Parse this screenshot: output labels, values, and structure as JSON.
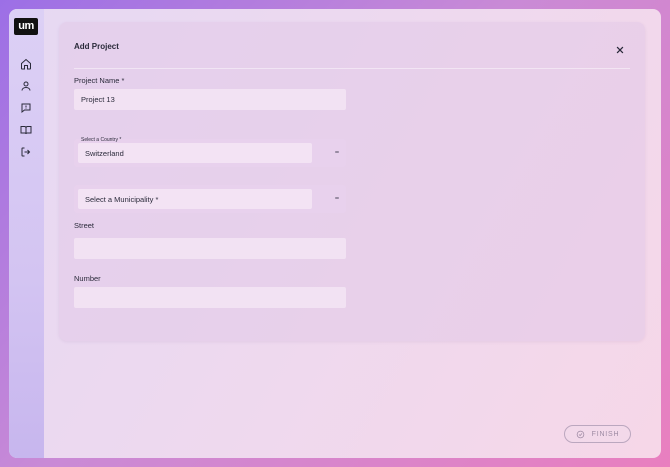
{
  "logo": {
    "text": "um"
  },
  "sidebar": {
    "items": [
      {
        "name": "home",
        "icon": "home-icon"
      },
      {
        "name": "profile",
        "icon": "user-icon"
      },
      {
        "name": "messages",
        "icon": "message-alert-icon"
      },
      {
        "name": "docs",
        "icon": "book-open-icon"
      },
      {
        "name": "logout",
        "icon": "logout-icon"
      }
    ]
  },
  "dialog": {
    "title": "Add Project",
    "close_icon": "close-icon",
    "project_name": {
      "label": "Project Name *",
      "value": "Project 13"
    },
    "country": {
      "label": "Select a Country *",
      "value": "Switzerland"
    },
    "municipality": {
      "placeholder": "Select a Municipality *",
      "value": ""
    },
    "street": {
      "label": "Street",
      "value": ""
    },
    "number": {
      "label": "Number",
      "value": ""
    }
  },
  "footer": {
    "finish_label": "FINISH",
    "finish_icon": "check-circle-icon"
  },
  "colors": {
    "sidebar_bg": "#d3c4f2",
    "panel_bg": "#e1c8e8",
    "finish_border": "#bba7bf",
    "finish_text": "#9d8aa3",
    "logo_bg": "#111111"
  }
}
